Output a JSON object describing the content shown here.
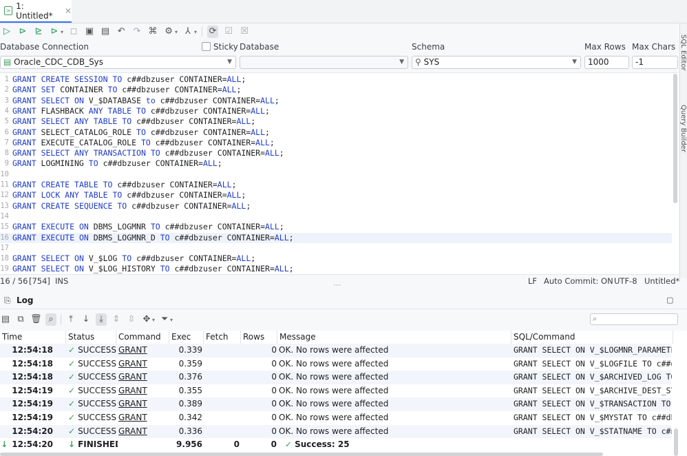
{
  "tab": {
    "title": "1: Untitled*"
  },
  "connection": {
    "db_conn_label": "Database Connection",
    "sticky_label": "Sticky",
    "database_label": "Database",
    "schema_label": "Schema",
    "max_rows_label": "Max Rows",
    "max_chars_label": "Max Chars",
    "connection_value": "Oracle_CDC_CDB_Sys",
    "schema_value": "SYS",
    "max_rows_value": "1000",
    "max_chars_value": "-1"
  },
  "side_panel": {
    "sql_editor": "SQL Editor",
    "query_builder": "Query Builder"
  },
  "editor_lines": [
    {
      "n": "1",
      "tokens": [
        [
          "kw",
          "GRANT"
        ],
        [
          "t",
          " "
        ],
        [
          "kw",
          "CREATE SESSION"
        ],
        [
          "t",
          " "
        ],
        [
          "kw",
          "TO"
        ],
        [
          "t",
          " c##dbzuser CONTAINER="
        ],
        [
          "kw",
          "ALL"
        ],
        [
          "t",
          ";"
        ]
      ]
    },
    {
      "n": "2",
      "tokens": [
        [
          "kw",
          "GRANT"
        ],
        [
          "t",
          " "
        ],
        [
          "kw",
          "SET"
        ],
        [
          "t",
          " CONTAINER "
        ],
        [
          "kw",
          "TO"
        ],
        [
          "t",
          " c##dbzuser CONTAINER="
        ],
        [
          "kw",
          "ALL"
        ],
        [
          "t",
          ";"
        ]
      ]
    },
    {
      "n": "3",
      "tokens": [
        [
          "kw",
          "GRANT"
        ],
        [
          "t",
          " "
        ],
        [
          "kw",
          "SELECT"
        ],
        [
          "t",
          " "
        ],
        [
          "kw",
          "ON"
        ],
        [
          "t",
          " V_$DATABASE "
        ],
        [
          "kw",
          "to"
        ],
        [
          "t",
          " c##dbzuser CONTAINER="
        ],
        [
          "kw",
          "ALL"
        ],
        [
          "t",
          ";"
        ]
      ]
    },
    {
      "n": "4",
      "tokens": [
        [
          "kw",
          "GRANT"
        ],
        [
          "t",
          " FLASHBACK "
        ],
        [
          "kw",
          "ANY TABLE"
        ],
        [
          "t",
          " "
        ],
        [
          "kw",
          "TO"
        ],
        [
          "t",
          " c##dbzuser CONTAINER="
        ],
        [
          "kw",
          "ALL"
        ],
        [
          "t",
          ";"
        ]
      ]
    },
    {
      "n": "5",
      "tokens": [
        [
          "kw",
          "GRANT"
        ],
        [
          "t",
          " "
        ],
        [
          "kw",
          "SELECT ANY TABLE"
        ],
        [
          "t",
          " "
        ],
        [
          "kw",
          "TO"
        ],
        [
          "t",
          " c##dbzuser CONTAINER="
        ],
        [
          "kw",
          "ALL"
        ],
        [
          "t",
          ";"
        ]
      ]
    },
    {
      "n": "6",
      "tokens": [
        [
          "kw",
          "GRANT"
        ],
        [
          "t",
          " SELECT_CATALOG_ROLE "
        ],
        [
          "kw",
          "TO"
        ],
        [
          "t",
          " c##dbzuser CONTAINER="
        ],
        [
          "kw",
          "ALL"
        ],
        [
          "t",
          ";"
        ]
      ]
    },
    {
      "n": "7",
      "tokens": [
        [
          "kw",
          "GRANT"
        ],
        [
          "t",
          " EXECUTE_CATALOG_ROLE "
        ],
        [
          "kw",
          "TO"
        ],
        [
          "t",
          " c##dbzuser CONTAINER="
        ],
        [
          "kw",
          "ALL"
        ],
        [
          "t",
          ";"
        ]
      ]
    },
    {
      "n": "8",
      "tokens": [
        [
          "kw",
          "GRANT"
        ],
        [
          "t",
          " "
        ],
        [
          "kw",
          "SELECT ANY TRANSACTION"
        ],
        [
          "t",
          " "
        ],
        [
          "kw",
          "TO"
        ],
        [
          "t",
          " c##dbzuser CONTAINER="
        ],
        [
          "kw",
          "ALL"
        ],
        [
          "t",
          ";"
        ]
      ]
    },
    {
      "n": "9",
      "tokens": [
        [
          "kw",
          "GRANT"
        ],
        [
          "t",
          " LOGMINING "
        ],
        [
          "kw",
          "TO"
        ],
        [
          "t",
          " c##dbzuser CONTAINER="
        ],
        [
          "kw",
          "ALL"
        ],
        [
          "t",
          ";"
        ]
      ]
    },
    {
      "n": "10",
      "tokens": []
    },
    {
      "n": "11",
      "tokens": [
        [
          "kw",
          "GRANT"
        ],
        [
          "t",
          " "
        ],
        [
          "kw",
          "CREATE TABLE"
        ],
        [
          "t",
          " "
        ],
        [
          "kw",
          "TO"
        ],
        [
          "t",
          " c##dbzuser CONTAINER="
        ],
        [
          "kw",
          "ALL"
        ],
        [
          "t",
          ";"
        ]
      ]
    },
    {
      "n": "12",
      "tokens": [
        [
          "kw",
          "GRANT"
        ],
        [
          "t",
          " "
        ],
        [
          "kw",
          "LOCK ANY TABLE"
        ],
        [
          "t",
          " "
        ],
        [
          "kw",
          "TO"
        ],
        [
          "t",
          " c##dbzuser CONTAINER="
        ],
        [
          "kw",
          "ALL"
        ],
        [
          "t",
          ";"
        ]
      ]
    },
    {
      "n": "13",
      "tokens": [
        [
          "kw",
          "GRANT"
        ],
        [
          "t",
          " "
        ],
        [
          "kw",
          "CREATE SEQUENCE"
        ],
        [
          "t",
          " "
        ],
        [
          "kw",
          "TO"
        ],
        [
          "t",
          " c##dbzuser CONTAINER="
        ],
        [
          "kw",
          "ALL"
        ],
        [
          "t",
          ";"
        ]
      ]
    },
    {
      "n": "14",
      "tokens": []
    },
    {
      "n": "15",
      "tokens": [
        [
          "kw",
          "GRANT"
        ],
        [
          "t",
          " "
        ],
        [
          "kw",
          "EXECUTE"
        ],
        [
          "t",
          " "
        ],
        [
          "kw",
          "ON"
        ],
        [
          "t",
          " DBMS_LOGMNR "
        ],
        [
          "kw",
          "TO"
        ],
        [
          "t",
          " c##dbzuser CONTAINER="
        ],
        [
          "kw",
          "ALL"
        ],
        [
          "t",
          ";"
        ]
      ]
    },
    {
      "n": "16",
      "tokens": [
        [
          "kw",
          "GRANT"
        ],
        [
          "t",
          " "
        ],
        [
          "kw",
          "EXECUTE"
        ],
        [
          "t",
          " "
        ],
        [
          "kw",
          "ON"
        ],
        [
          "t",
          " DBMS_LOGMNR_D "
        ],
        [
          "kw",
          "TO"
        ],
        [
          "t",
          " c##dbzuser CONTAINER="
        ],
        [
          "kw",
          "ALL"
        ],
        [
          "t",
          ";"
        ]
      ]
    },
    {
      "n": "17",
      "tokens": []
    },
    {
      "n": "18",
      "tokens": [
        [
          "kw",
          "GRANT"
        ],
        [
          "t",
          " "
        ],
        [
          "kw",
          "SELECT"
        ],
        [
          "t",
          " "
        ],
        [
          "kw",
          "ON"
        ],
        [
          "t",
          " V_$LOG "
        ],
        [
          "kw",
          "TO"
        ],
        [
          "t",
          " c##dbzuser CONTAINER="
        ],
        [
          "kw",
          "ALL"
        ],
        [
          "t",
          ";"
        ]
      ]
    },
    {
      "n": "19",
      "tokens": [
        [
          "kw",
          "GRANT"
        ],
        [
          "t",
          " "
        ],
        [
          "kw",
          "SELECT"
        ],
        [
          "t",
          " "
        ],
        [
          "kw",
          "ON"
        ],
        [
          "t",
          " V_$LOG_HISTORY "
        ],
        [
          "kw",
          "TO"
        ],
        [
          "t",
          " c##dbzuser CONTAINER="
        ],
        [
          "kw",
          "ALL"
        ],
        [
          "t",
          ";"
        ]
      ]
    }
  ],
  "status_bar": {
    "position": "16 / 56",
    "offset": "[754]",
    "mode": "INS",
    "line_ending": "LF",
    "auto_commit": "Auto Commit: ON",
    "encoding": "UTF-8",
    "file": "Untitled*"
  },
  "log": {
    "title": "Log",
    "columns": [
      "Time",
      "Status",
      "Command",
      "Exec",
      "Fetch",
      "Rows",
      "Message",
      "SQL/Command"
    ],
    "rows": [
      {
        "time": "12:54:18",
        "status": "SUCCESS",
        "command": "GRANT",
        "exec": "0.339",
        "fetch": "",
        "rows": "0",
        "message": "OK. No rows were affected",
        "sql": "GRANT SELECT ON V_$LOGMNR_PARAMETE"
      },
      {
        "time": "12:54:18",
        "status": "SUCCESS",
        "command": "GRANT",
        "exec": "0.359",
        "fetch": "",
        "rows": "0",
        "message": "OK. No rows were affected",
        "sql": "GRANT SELECT ON V_$LOGFILE TO c##d"
      },
      {
        "time": "12:54:18",
        "status": "SUCCESS",
        "command": "GRANT",
        "exec": "0.376",
        "fetch": "",
        "rows": "0",
        "message": "OK. No rows were affected",
        "sql": "GRANT SELECT ON V_$ARCHIVED_LOG TO"
      },
      {
        "time": "12:54:19",
        "status": "SUCCESS",
        "command": "GRANT",
        "exec": "0.355",
        "fetch": "",
        "rows": "0",
        "message": "OK. No rows were affected",
        "sql": "GRANT SELECT ON V_$ARCHIVE_DEST_ST"
      },
      {
        "time": "12:54:19",
        "status": "SUCCESS",
        "command": "GRANT",
        "exec": "0.389",
        "fetch": "",
        "rows": "0",
        "message": "OK. No rows were affected",
        "sql": "GRANT SELECT ON V_$TRANSACTION TO"
      },
      {
        "time": "12:54:19",
        "status": "SUCCESS",
        "command": "GRANT",
        "exec": "0.342",
        "fetch": "",
        "rows": "0",
        "message": "OK. No rows were affected",
        "sql": "GRANT SELECT ON V_$MYSTAT TO c##db"
      },
      {
        "time": "12:54:20",
        "status": "SUCCESS",
        "command": "GRANT",
        "exec": "0.336",
        "fetch": "",
        "rows": "0",
        "message": "OK. No rows were affected",
        "sql": "GRANT SELECT ON V_$STATNAME TO c##"
      }
    ],
    "finished": {
      "time": "12:54:20",
      "status": "FINISHED",
      "exec": "9.956",
      "fetch": "0",
      "rows": "0",
      "message": "Success: 25"
    }
  },
  "colors": {
    "keyword": "#1f3cc2",
    "success": "#3d9b5a",
    "accent": "#3574f0"
  }
}
